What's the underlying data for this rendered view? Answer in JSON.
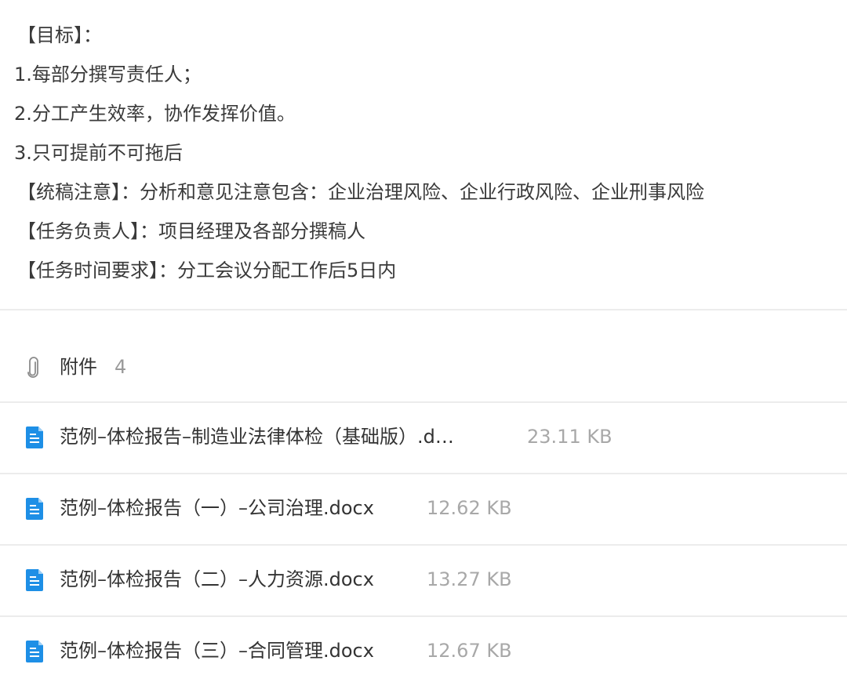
{
  "description": {
    "lines": [
      "【目标】：",
      "1.每部分撰写责任人；",
      "2.分工产生效率，协作发挥价值。",
      "3.只可提前不可拖后",
      "【统稿注意】：分析和意见注意包含：企业治理风险、企业行政风险、企业刑事风险",
      "【任务负责人】：项目经理及各部分撰稿人",
      "【任务时间要求】：分工会议分配工作后5日内"
    ]
  },
  "attachments": {
    "icon": "paperclip-icon",
    "title": "附件",
    "count": "4",
    "files": [
      {
        "name": "范例–体检报告–制造业法律体检（基础版）.d…",
        "size": "23.11 KB",
        "icon": "docx-file-icon"
      },
      {
        "name": "范例–体检报告（一）–公司治理.docx",
        "size": "12.62 KB",
        "icon": "docx-file-icon"
      },
      {
        "name": "范例–体检报告（二）–人力资源.docx",
        "size": "13.27 KB",
        "icon": "docx-file-icon"
      },
      {
        "name": "范例–体检报告（三）–合同管理.docx",
        "size": "12.67 KB",
        "icon": "docx-file-icon"
      }
    ]
  },
  "colors": {
    "text": "#333333",
    "muted": "#a8a8a8",
    "divider": "#ececec",
    "file_icon_blue": "#1e8fe6"
  }
}
